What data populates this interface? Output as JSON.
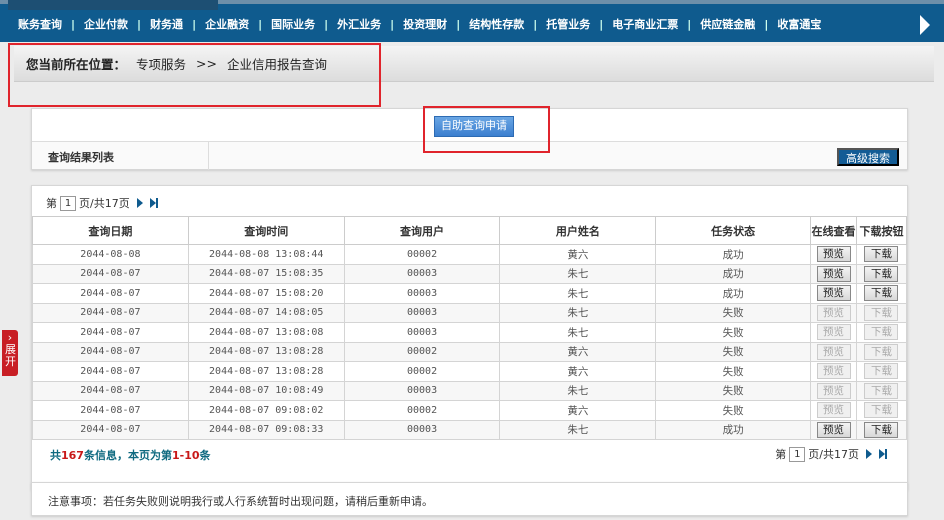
{
  "nav": {
    "items": [
      "账务查询",
      "企业付款",
      "财务通",
      "企业融资",
      "国际业务",
      "外汇业务",
      "投资理财",
      "结构性存款",
      "托管业务",
      "电子商业汇票",
      "供应链金融",
      "收富通宝"
    ]
  },
  "breadcrumb": {
    "lead": "您当前所在位置：",
    "level1": "专项服务",
    "sep": ">>",
    "level2": "企业信用报告查询"
  },
  "actions": {
    "apply_label": "自助查询申请",
    "results_label": "查询结果列表",
    "advanced_search": "高级搜索"
  },
  "pager": {
    "prefix": "第",
    "page": "1",
    "suffix": "页/共17页"
  },
  "table": {
    "headers": [
      "查询日期",
      "查询时间",
      "查询用户",
      "用户姓名",
      "任务状态",
      "在线查看",
      "下载按钮"
    ],
    "rows": [
      {
        "date": "2044-08-08",
        "time": "2044-08-08 13:08:44",
        "user": "00002",
        "name": "黄六",
        "status": "成功",
        "enabled": true
      },
      {
        "date": "2044-08-07",
        "time": "2044-08-07 15:08:35",
        "user": "00003",
        "name": "朱七",
        "status": "成功",
        "enabled": true
      },
      {
        "date": "2044-08-07",
        "time": "2044-08-07 15:08:20",
        "user": "00003",
        "name": "朱七",
        "status": "成功",
        "enabled": true
      },
      {
        "date": "2044-08-07",
        "time": "2044-08-07 14:08:05",
        "user": "00003",
        "name": "朱七",
        "status": "失败",
        "enabled": false
      },
      {
        "date": "2044-08-07",
        "time": "2044-08-07 13:08:08",
        "user": "00003",
        "name": "朱七",
        "status": "失败",
        "enabled": false
      },
      {
        "date": "2044-08-07",
        "time": "2044-08-07 13:08:28",
        "user": "00002",
        "name": "黄六",
        "status": "失败",
        "enabled": false
      },
      {
        "date": "2044-08-07",
        "time": "2044-08-07 13:08:28",
        "user": "00002",
        "name": "黄六",
        "status": "失败",
        "enabled": false
      },
      {
        "date": "2044-08-07",
        "time": "2044-08-07 10:08:49",
        "user": "00003",
        "name": "朱七",
        "status": "失败",
        "enabled": false
      },
      {
        "date": "2044-08-07",
        "time": "2044-08-07 09:08:02",
        "user": "00002",
        "name": "黄六",
        "status": "失败",
        "enabled": false
      },
      {
        "date": "2044-08-07",
        "time": "2044-08-07 09:08:33",
        "user": "00003",
        "name": "朱七",
        "status": "成功",
        "enabled": true
      }
    ],
    "preview_label": "预览",
    "download_label": "下载"
  },
  "summary": {
    "a": "共",
    "total": "167",
    "b": "条信息，本页为第",
    "range": "1-10",
    "c": "条"
  },
  "side": {
    "expand_label": "展开"
  },
  "notice": "注意事项：若任务失败则说明我行或人行系统暂时出现问题，请稍后重新申请。",
  "colors": {
    "nav": "#0f5b8e",
    "highlight": "#e0242c"
  }
}
